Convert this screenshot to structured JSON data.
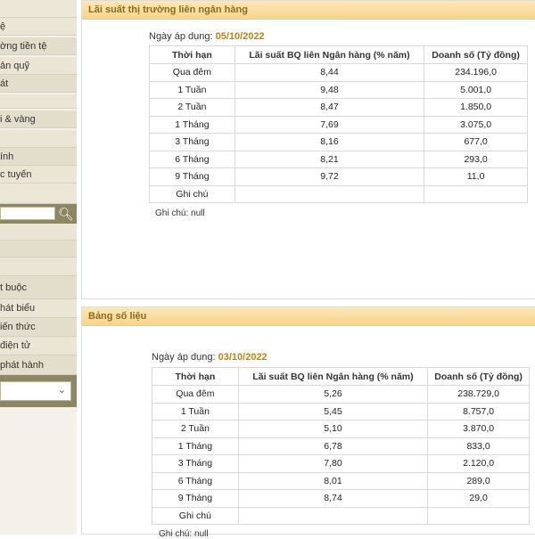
{
  "sidebar": {
    "items": [
      {
        "label": "ệ"
      },
      {
        "label": "ờng tiền tệ"
      },
      {
        "label": "ản quỹ"
      },
      {
        "label": "át"
      },
      {
        "label": ""
      },
      {
        "label": "i & vàng"
      },
      {
        "label": ""
      },
      {
        "label": "ính"
      },
      {
        "label": "c tuyến"
      }
    ],
    "items2": [
      {
        "label": ""
      },
      {
        "label": ""
      },
      {
        "label": ""
      },
      {
        "label": "t buộc"
      },
      {
        "label": "hát biểu"
      },
      {
        "label": "iến thức"
      },
      {
        "label": "điện tử"
      },
      {
        "label": "phát hành"
      }
    ]
  },
  "panel1": {
    "title": "Lãi suất thị trường liên ngân hàng",
    "apply_label": "Ngày áp dụng: ",
    "apply_date": "05/10/2022",
    "headers": [
      "Thời hạn",
      "Lãi suất BQ liên Ngân hàng (% năm)",
      "Doanh số (Tỷ đồng)"
    ],
    "rows": [
      [
        "Qua đêm",
        "8,44",
        "234.196,0"
      ],
      [
        "1 Tuần",
        "9,48",
        "5.001,0"
      ],
      [
        "2 Tuần",
        "8,47",
        "1.850,0"
      ],
      [
        "1 Tháng",
        "7,69",
        "3.075,0"
      ],
      [
        "3 Tháng",
        "8,16",
        "677,0"
      ],
      [
        "6 Tháng",
        "8,21",
        "293,0"
      ],
      [
        "9 Tháng",
        "9,72",
        "11,0"
      ],
      [
        "Ghi chú",
        "",
        ""
      ]
    ],
    "note": "Ghi chú: null"
  },
  "panel2": {
    "title": "Bảng số liệu",
    "apply_label": "Ngày áp dụng: ",
    "apply_date": "03/10/2022",
    "headers": [
      "Thời hạn",
      "Lãi suất BQ liên Ngân hàng (% năm)",
      "Doanh số (Tỷ đồng)"
    ],
    "rows": [
      [
        "Qua đêm",
        "5,26",
        "238.729,0"
      ],
      [
        "1 Tuần",
        "5,45",
        "8.757,0"
      ],
      [
        "2 Tuần",
        "5,10",
        "3.870,0"
      ],
      [
        "1 Tháng",
        "6,78",
        "833,0"
      ],
      [
        "3 Tháng",
        "7,80",
        "2.120,0"
      ],
      [
        "6 Tháng",
        "8,01",
        "289,0"
      ],
      [
        "9 Tháng",
        "8,74",
        "29,0"
      ],
      [
        "Ghi chú",
        "",
        ""
      ]
    ],
    "note": "Ghi chú: null"
  },
  "icons": {
    "search": "search-icon",
    "dropdown": "chevron-down-icon"
  },
  "colors": {
    "header_gold": "#8a6c1e",
    "date_gold": "#b8860b",
    "sidebar_olive": "#8c8662"
  }
}
